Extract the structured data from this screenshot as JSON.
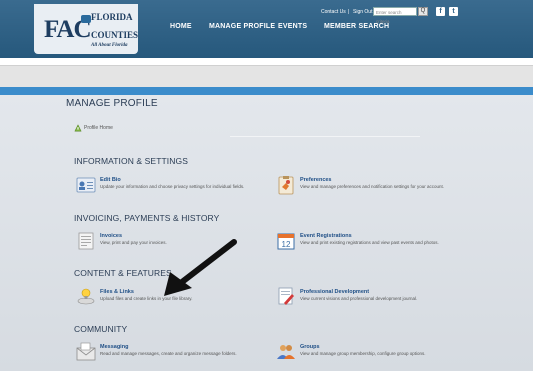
{
  "header": {
    "logo": {
      "abbr": "FAC",
      "line1": "FLORIDA",
      "line2": "COUNTIES",
      "tagline": "All About Florida"
    },
    "nav": {
      "home": "HOME",
      "manage_profile": "MANAGE PROFILE",
      "events": "EVENTS",
      "member_search": "MEMBER SEARCH"
    },
    "utility": {
      "contact": "Contact Us",
      "separator": "|",
      "sign_out": "Sign Out",
      "search_placeholder": "Enter search criteria",
      "search_button": "Q"
    },
    "social": {
      "facebook": "f",
      "twitter": "t"
    }
  },
  "page": {
    "title": "MANAGE PROFILE",
    "breadcrumb": "Profile Home"
  },
  "sections": [
    {
      "title": "INFORMATION & SETTINGS",
      "items": [
        {
          "title": "Edit Bio",
          "desc": "Update your information and choose privacy settings for individual fields.",
          "icon": "edit-bio-icon"
        },
        {
          "title": "Preferences",
          "desc": "View and manage preferences and notification settings for your account.",
          "icon": "preferences-icon"
        }
      ]
    },
    {
      "title": "INVOICING, PAYMENTS & HISTORY",
      "items": [
        {
          "title": "Invoices",
          "desc": "View, print and pay your invoices.",
          "icon": "invoices-icon"
        },
        {
          "title": "Event Registrations",
          "desc": "View and print existing registrations and view past events and photos.",
          "icon": "calendar-icon"
        }
      ]
    },
    {
      "title": "CONTENT & FEATURES",
      "items": [
        {
          "title": "Files & Links",
          "desc": "Upload files and create links in your file library.",
          "icon": "files-links-icon"
        },
        {
          "title": "Professional Development",
          "desc": "View current visions and professional development journal.",
          "icon": "professional-development-icon"
        }
      ]
    },
    {
      "title": "COMMUNITY",
      "items": [
        {
          "title": "Messaging",
          "desc": "Read and manage messages, create and organize message folders.",
          "icon": "messaging-icon"
        },
        {
          "title": "Groups",
          "desc": "View and manage group membership, configure group options.",
          "icon": "groups-icon"
        }
      ]
    }
  ],
  "colors": {
    "header": "#2f6186",
    "accent_bar": "#3b8ccb",
    "link": "#1f4f86",
    "section_title": "#2b3d55"
  }
}
